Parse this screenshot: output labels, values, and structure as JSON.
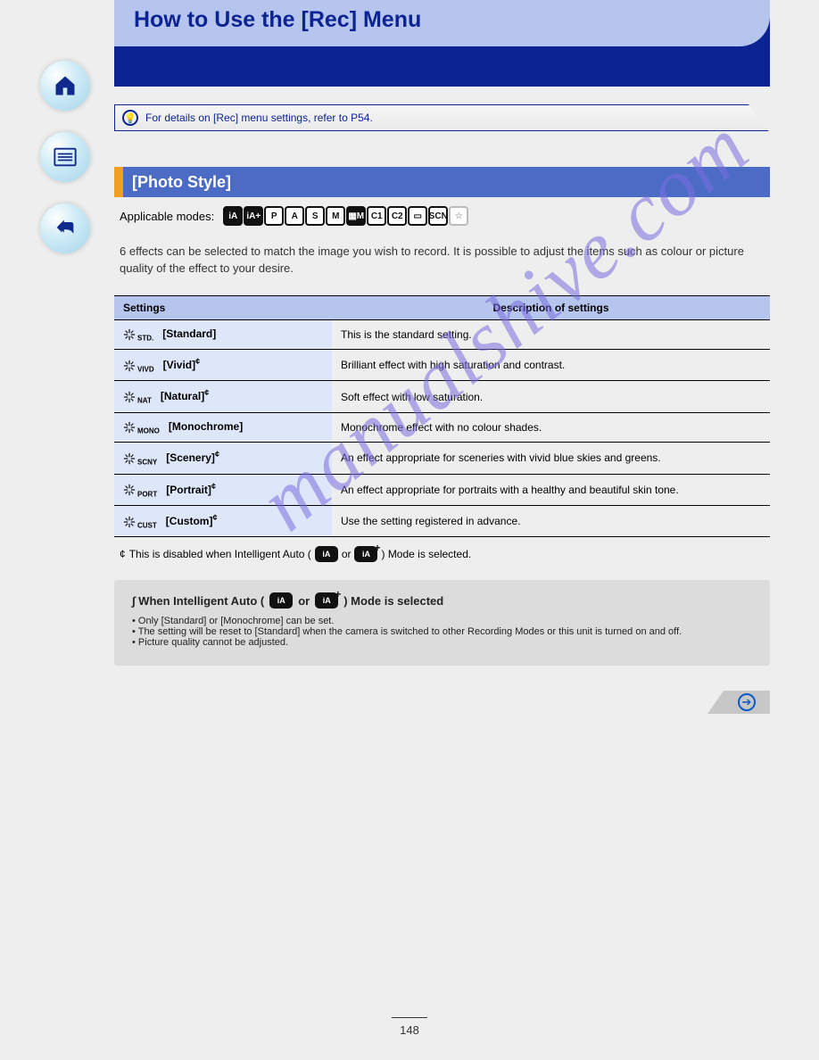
{
  "sidebar": {
    "home_label": "Home",
    "menu_label": "Menu",
    "back_label": "Back"
  },
  "header": {
    "title": "How to Use the [Rec] Menu"
  },
  "info_tip": {
    "text": "For details on [Rec] menu settings, refer to P54."
  },
  "section": {
    "title": "[Photo Style]"
  },
  "modes": {
    "label": "Applicable modes:",
    "icons": [
      {
        "text": "iA",
        "type": "solid"
      },
      {
        "text": "iA+",
        "type": "solid"
      },
      {
        "text": "P",
        "type": "outline"
      },
      {
        "text": "A",
        "type": "outline"
      },
      {
        "text": "S",
        "type": "outline"
      },
      {
        "text": "M",
        "type": "outline"
      },
      {
        "text": "▦M",
        "type": "solid"
      },
      {
        "text": "C1",
        "type": "outline"
      },
      {
        "text": "C2",
        "type": "outline"
      },
      {
        "text": "▭",
        "type": "outline"
      },
      {
        "text": "SCN",
        "type": "outline"
      },
      {
        "text": "☆",
        "type": "faded"
      }
    ]
  },
  "description": "6 effects can be selected to match the image you wish to record. It is possible to adjust the items such as colour or picture quality of the effect to your desire.",
  "table": {
    "headers": [
      "Settings",
      "Description of settings"
    ],
    "rows": [
      {
        "code": "STD.",
        "name": "[Standard]",
        "desc": "This is the standard setting."
      },
      {
        "code": "VIVD",
        "name": "[Vivid]",
        "star": "*",
        "desc": "Brilliant effect with high saturation and contrast."
      },
      {
        "code": "NAT",
        "name": "[Natural]",
        "star": "*",
        "desc": "Soft effect with low saturation."
      },
      {
        "code": "MONO",
        "name": "[Monochrome]",
        "desc": "Monochrome effect with no colour shades."
      },
      {
        "code": "SCNY",
        "name": "[Scenery]",
        "star": "*",
        "desc": "An effect appropriate for sceneries with vivid blue skies and greens."
      },
      {
        "code": "PORT",
        "name": "[Portrait]",
        "star": "*",
        "desc": "An effect appropriate for portraits with a healthy and beautiful skin tone."
      },
      {
        "code": "CUST",
        "name": "[Custom]",
        "star": "*",
        "desc": "Use the setting registered in advance."
      }
    ]
  },
  "footnote": {
    "prefix": "¢",
    "text_before": "This is disabled when Intelligent Auto (",
    "text_mid": " or ",
    "text_after": ") Mode is selected."
  },
  "callout": {
    "title_lead": "∫ When Intelligent Auto (",
    "title_mid": " or ",
    "title_after": ") Mode is selected",
    "bullet1": "Only [Standard] or [Monochrome] can be set.",
    "bullet2": "The setting will be reset to [Standard] when the camera is switched to other Recording Modes or this unit is turned on and off.",
    "bullet3": "Picture quality cannot be adjusted."
  },
  "page_number": "148",
  "watermark": "manualshive.com"
}
